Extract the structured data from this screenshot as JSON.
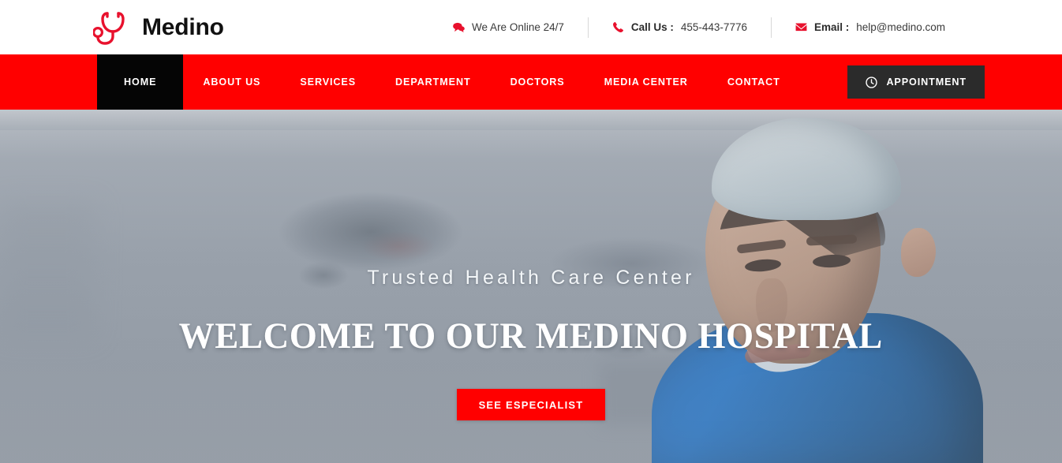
{
  "brand": {
    "name": "Medino",
    "logo_icon": "stethoscope-icon",
    "accent_color": "#ff0000",
    "logo_icon_color": "#e8112d"
  },
  "topbar": {
    "items": [
      {
        "icon": "chat-bubbles-icon",
        "label": "We Are Online 24/7",
        "value": ""
      },
      {
        "icon": "phone-icon",
        "label": "Call Us :",
        "value": "455-443-7776"
      },
      {
        "icon": "envelope-icon",
        "label": "Email :",
        "value": "help@medino.com"
      }
    ]
  },
  "nav": {
    "items": [
      {
        "label": "HOME",
        "active": true
      },
      {
        "label": "ABOUT US",
        "active": false
      },
      {
        "label": "SERVICES",
        "active": false
      },
      {
        "label": "DEPARTMENT",
        "active": false
      },
      {
        "label": "DOCTORS",
        "active": false
      },
      {
        "label": "MEDIA CENTER",
        "active": false
      },
      {
        "label": "CONTACT",
        "active": false
      }
    ],
    "appointment_label": "APPOINTMENT",
    "appointment_icon": "clock-icon",
    "bar_color": "#ff0000",
    "active_color": "#050505",
    "appointment_bg": "#2b2b2b"
  },
  "hero": {
    "subtitle": "Trusted Health Care Center",
    "title": "WELCOME TO OUR MEDINO HOSPITAL",
    "cta_label": "SEE ESPECIALIST",
    "cta_color": "#ff0000",
    "background_description": "Blurred operating room with surgical lamps and a doctor in blue scrubs wearing a surgical cap"
  }
}
